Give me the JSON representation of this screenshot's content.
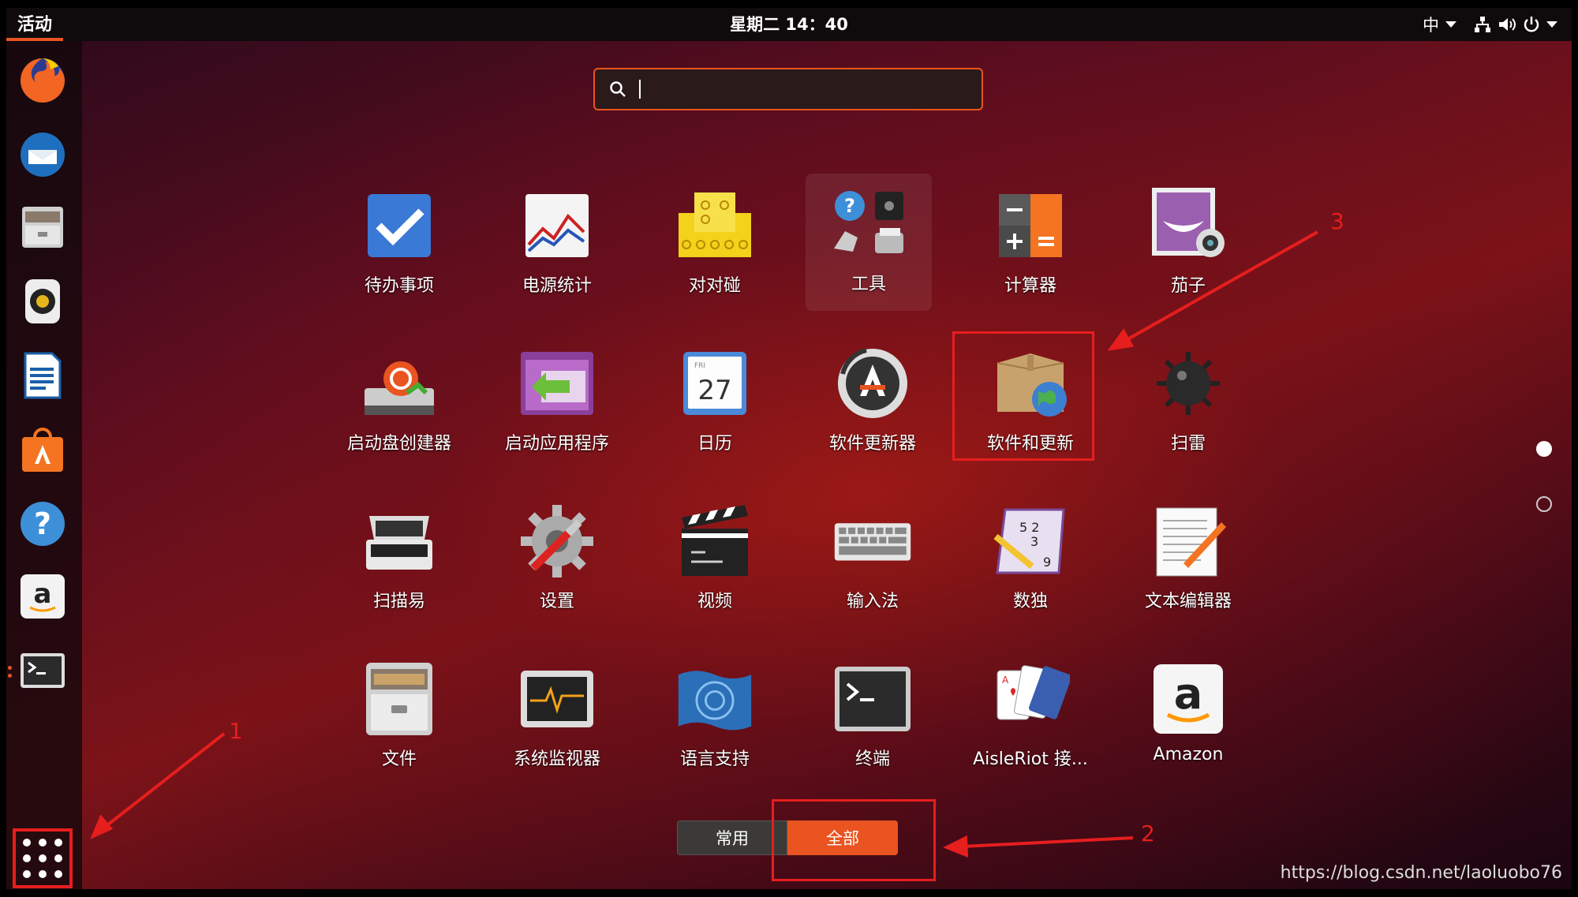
{
  "topbar": {
    "activities": "活动",
    "clock": "星期二 14：40",
    "input_method": "中"
  },
  "dock": {
    "apps": [
      {
        "name": "firefox",
        "icon": "firefox-icon"
      },
      {
        "name": "thunderbird",
        "icon": "thunderbird-icon"
      },
      {
        "name": "files",
        "icon": "files-icon"
      },
      {
        "name": "rhythmbox",
        "icon": "rhythmbox-icon"
      },
      {
        "name": "writer",
        "icon": "writer-icon"
      },
      {
        "name": "software",
        "icon": "software-center-icon"
      },
      {
        "name": "help",
        "icon": "help-icon"
      },
      {
        "name": "amazon",
        "icon": "amazon-icon"
      },
      {
        "name": "terminal",
        "icon": "terminal-icon"
      }
    ]
  },
  "search": {
    "value": "",
    "placeholder": ""
  },
  "apps": [
    {
      "label": "待办事项",
      "icon": "todo-icon"
    },
    {
      "label": "电源统计",
      "icon": "power-stats-icon"
    },
    {
      "label": "对对碰",
      "icon": "swell-foop-icon"
    },
    {
      "label": "工具",
      "icon": "tools-folder-icon"
    },
    {
      "label": "计算器",
      "icon": "calculator-icon"
    },
    {
      "label": "茄子",
      "icon": "cheese-icon"
    },
    {
      "label": "启动盘创建器",
      "icon": "usb-creator-icon"
    },
    {
      "label": "启动应用程序",
      "icon": "startup-apps-icon"
    },
    {
      "label": "日历",
      "icon": "calendar-icon"
    },
    {
      "label": "软件更新器",
      "icon": "software-updater-icon"
    },
    {
      "label": "软件和更新",
      "icon": "software-properties-icon"
    },
    {
      "label": "扫雷",
      "icon": "mines-icon"
    },
    {
      "label": "扫描易",
      "icon": "scanner-icon"
    },
    {
      "label": "设置",
      "icon": "settings-icon"
    },
    {
      "label": "视频",
      "icon": "videos-icon"
    },
    {
      "label": "输入法",
      "icon": "input-method-icon"
    },
    {
      "label": "数独",
      "icon": "sudoku-icon"
    },
    {
      "label": "文本编辑器",
      "icon": "text-editor-icon"
    },
    {
      "label": "文件",
      "icon": "files-icon"
    },
    {
      "label": "系统监视器",
      "icon": "system-monitor-icon"
    },
    {
      "label": "语言支持",
      "icon": "language-support-icon"
    },
    {
      "label": "终端",
      "icon": "terminal-icon"
    },
    {
      "label": "AisleRiot 接...",
      "icon": "aisleriot-icon"
    },
    {
      "label": "Amazon",
      "icon": "amazon-icon"
    }
  ],
  "calendar_day": "27",
  "calendar_weekday": "FRI",
  "toggle": {
    "frequent": "常用",
    "all": "全部"
  },
  "annotations": {
    "one": "1",
    "two": "2",
    "three": "3"
  },
  "watermark": "https://blog.csdn.net/laoluobo76",
  "colors": {
    "accent": "#e95420",
    "annotation": "#e61e1e"
  }
}
